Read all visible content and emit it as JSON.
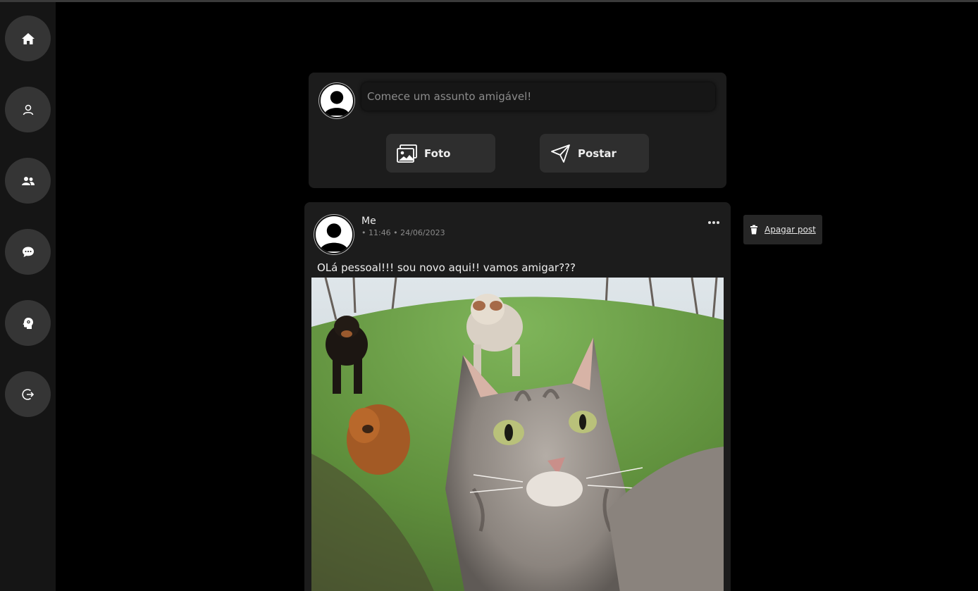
{
  "sidebar": {
    "items": [
      {
        "icon": "home-icon"
      },
      {
        "icon": "user-icon"
      },
      {
        "icon": "friends-icon"
      },
      {
        "icon": "chat-icon"
      },
      {
        "icon": "brain-icon"
      },
      {
        "icon": "logout-icon"
      }
    ]
  },
  "composer": {
    "placeholder": "Comece um assunto amigável!",
    "photo_label": "Foto",
    "post_label": "Postar"
  },
  "post": {
    "author": "Me",
    "meta": "• 11:46 • 24/06/2023",
    "text": "OLá pessoal!!! sou novo aqui!! vamos amigar???"
  },
  "post_menu": {
    "delete_label": "Apagar post"
  },
  "colors": {
    "background": "#000000",
    "sidebar": "#151515",
    "card": "#1c1c1c",
    "button": "#2e2e2e",
    "nav_button": "#353535"
  }
}
